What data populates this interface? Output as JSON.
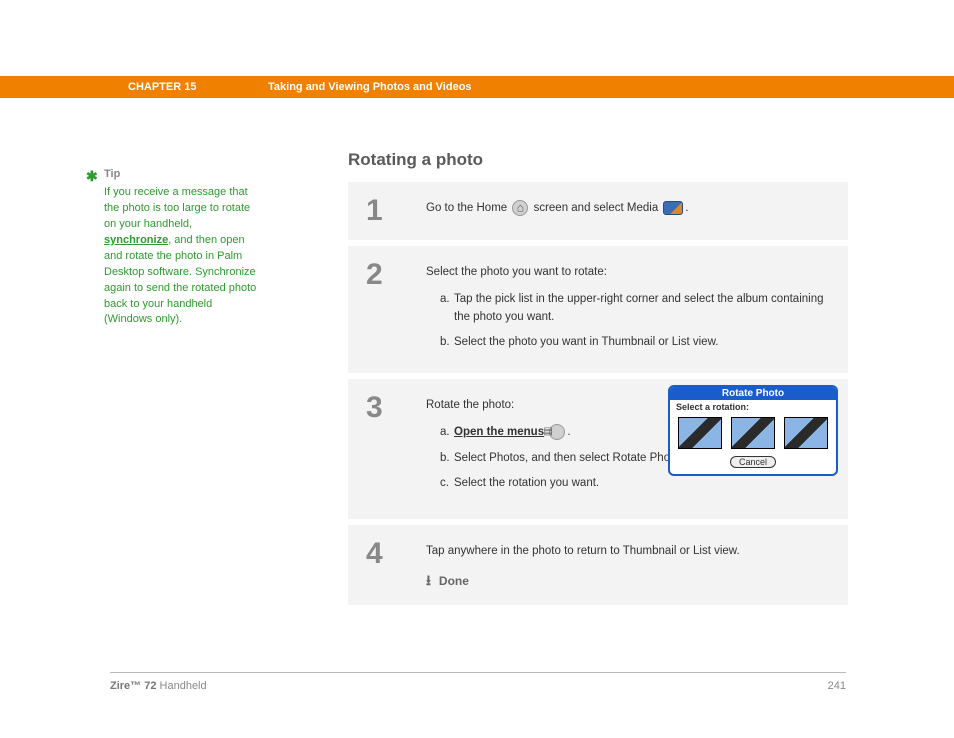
{
  "header": {
    "chapter_label": "CHAPTER 15",
    "chapter_title": "Taking and Viewing Photos and Videos"
  },
  "tip": {
    "title": "Tip",
    "text_before_link": "If you receive a message that the photo is too large to rotate on your handheld, ",
    "link": "synchronize",
    "text_after_link": ", and then open and rotate the photo in Palm Desktop software. Synchronize again to send the rotated photo back to your handheld (Windows only)."
  },
  "section_title": "Rotating a photo",
  "steps": {
    "s1": {
      "num": "1",
      "pre_home": "Go to the Home ",
      "between": " screen and select Media ",
      "after": "."
    },
    "s2": {
      "num": "2",
      "intro": "Select the photo you want to rotate:",
      "a": "Tap the pick list in the upper-right corner and select the album containing the photo you want.",
      "b": "Select the photo you want in Thumbnail or List view."
    },
    "s3": {
      "num": "3",
      "intro": "Rotate the photo:",
      "a_link": "Open the menus",
      "a_after": ".",
      "b": "Select Photos, and then select Rotate Photo.",
      "c": "Select the rotation you want.",
      "dialog": {
        "title": "Rotate Photo",
        "subtitle": "Select a rotation:",
        "cancel": "Cancel"
      }
    },
    "s4": {
      "num": "4",
      "text": "Tap anywhere in the photo to return to Thumbnail or List view.",
      "done": "Done"
    }
  },
  "footer": {
    "product_bold": "Zire™ 72",
    "product_rest": " Handheld",
    "page": "241"
  }
}
